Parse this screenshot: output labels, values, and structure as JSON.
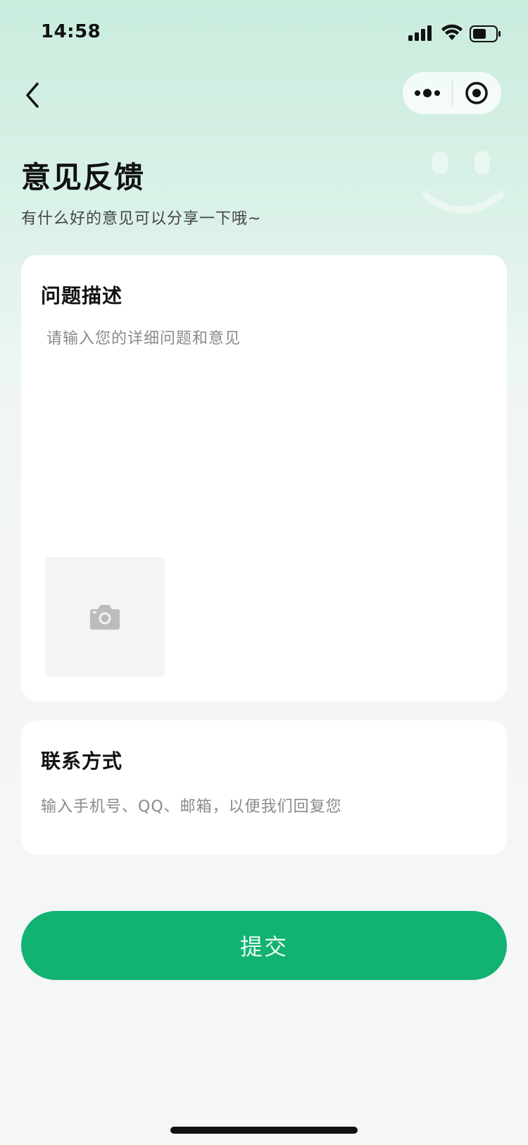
{
  "status_bar": {
    "time": "14:58",
    "icons": [
      "signal-icon",
      "wifi-icon",
      "battery-icon"
    ]
  },
  "nav": {
    "back_icon": "chevron-left-icon",
    "capsule_icons": [
      "more-dots-icon",
      "close-target-icon"
    ]
  },
  "header": {
    "title": "意见反馈",
    "subtitle": "有什么好的意见可以分享一下哦~",
    "decoration_icon": "smiley-icon"
  },
  "description": {
    "label": "问题描述",
    "placeholder": "请输入您的详细问题和意见",
    "value": "",
    "upload_icon": "camera-icon"
  },
  "contact": {
    "label": "联系方式",
    "placeholder": "输入手机号、QQ、邮箱，以便我们回复您",
    "value": ""
  },
  "submit": {
    "label": "提交"
  },
  "colors": {
    "accent": "#12b273",
    "header_gradient_top": "#c9ecdd",
    "background": "#f6f6f6"
  }
}
